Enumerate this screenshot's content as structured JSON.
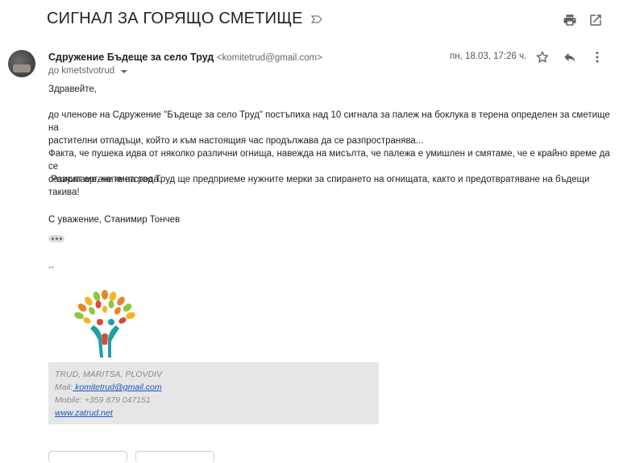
{
  "email": {
    "subject": "СИГНАЛ ЗА ГОРЯЩО СМЕТИЩЕ",
    "sender_name": "Сдружение Бъдеще за село Труд",
    "sender_email": "<komitetrud@gmail.com>",
    "to_line": "до kmetstvotrud",
    "date": "пн, 18.03, 17:26 ч.",
    "greeting": "Здравейте,",
    "paragraph1_line1": "до членове на Сдружение \"Бъдеще за село Труд\" постъпиха над 10 сигнала за палеж на боклука в терена определен за сметище на",
    "paragraph1_line2": "растителни отпадъци, който и към настоящия час продължава да се разпространява...",
    "paragraph1_line3": "Факта, че пушека идва от няколко различни огнища, навежда на мисълта, че палежа е умишлен и смятаме, че е крайно време да се",
    "paragraph1_line4": "сезират органите на реда.",
    "paragraph2_line1": " Разчитаме, че кметство Труд ще предприеме нужните мерки за спирането на огнищата, както и предотвратяване на бъдещи",
    "paragraph2_line2": "такива!",
    "signoff": "С уважение, Станимир Тончев",
    "dash": "--"
  },
  "signature": {
    "org": "TRUD, MARITSA, PLOVDIV",
    "mail_label": "Mail:",
    "mail_link": " komitetrud@gmail.com",
    "mobile": "Mobile: +359 879 047151",
    "website": "www.zatrud.net"
  },
  "icons": {
    "important": "important-label-icon",
    "print": "print-icon",
    "new_window": "open-in-new-window-icon",
    "star": "star-icon",
    "reply": "reply-icon",
    "more": "more-vert-icon"
  }
}
